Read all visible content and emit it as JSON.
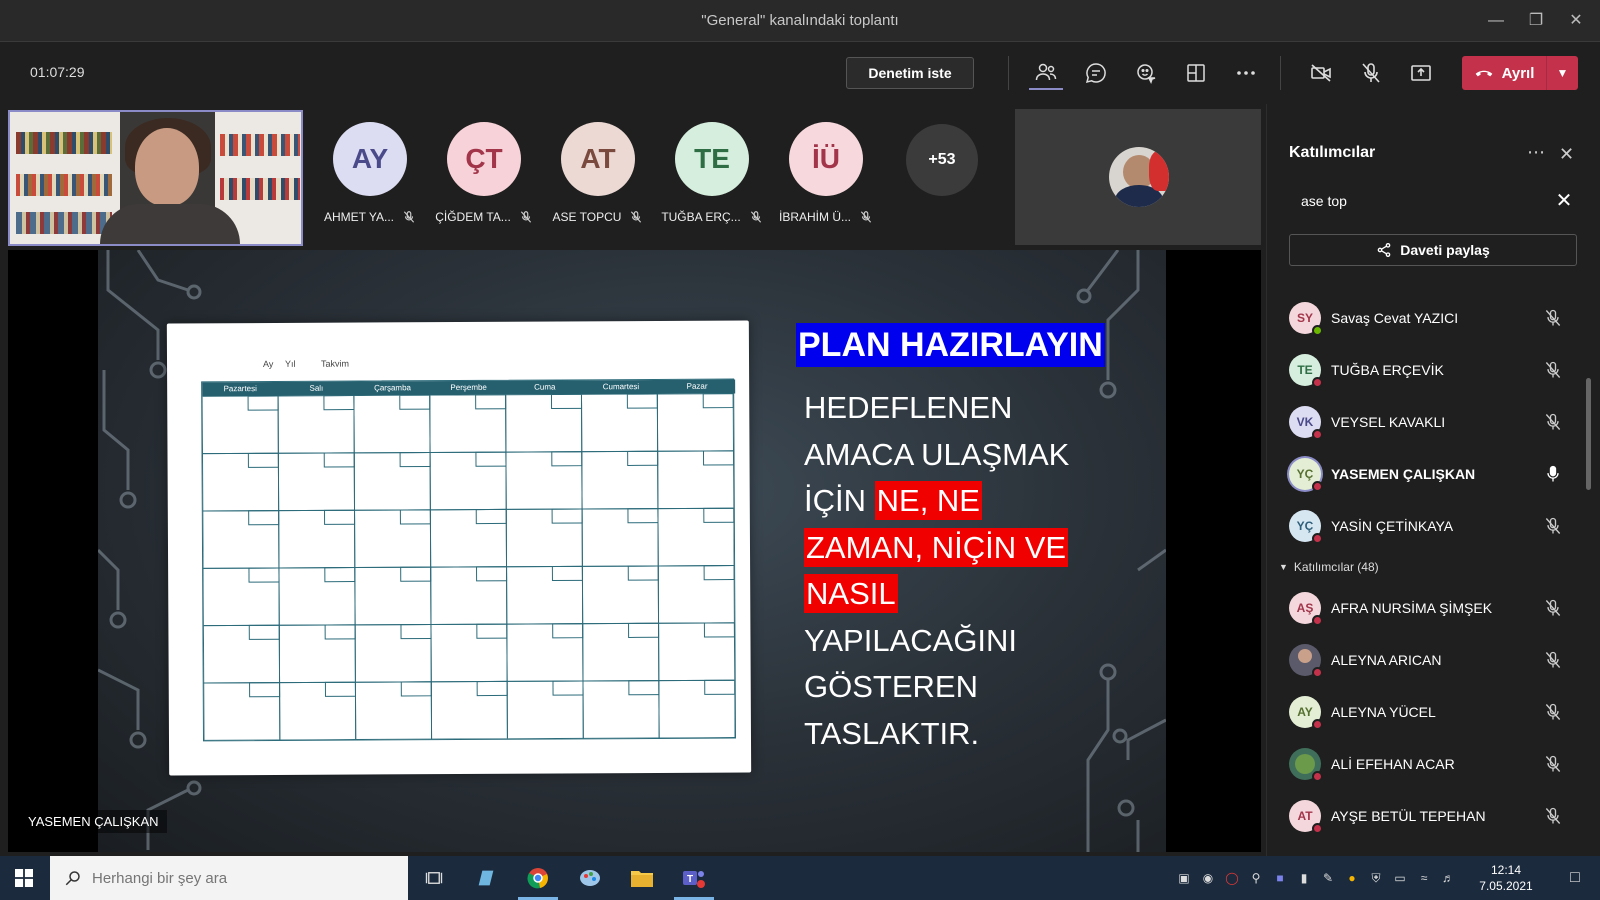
{
  "window": {
    "title": "\"General\" kanalındaki toplantı"
  },
  "toolbar": {
    "timer": "01:07:29",
    "request_control_label": "Denetim iste",
    "leave_label": "Ayrıl",
    "icons": [
      "people-icon",
      "chat-icon",
      "reactions-icon",
      "view-icon",
      "more-icon",
      "camera-off-icon",
      "mic-off-icon",
      "share-icon"
    ]
  },
  "gallery": {
    "avatars": [
      {
        "initials": "AY",
        "name": "AHMET YA...",
        "bg": "#dcdcf2",
        "fg": "#4a4a8a"
      },
      {
        "initials": "ÇT",
        "name": "ÇİĞDEM TA...",
        "bg": "#f7d2d8",
        "fg": "#a2354a"
      },
      {
        "initials": "AT",
        "name": "ASE TOPCU",
        "bg": "#ecd9d4",
        "fg": "#7a4a3e"
      },
      {
        "initials": "TE",
        "name": "TUĞBA ERÇ...",
        "bg": "#d5eedd",
        "fg": "#2f6e45"
      },
      {
        "initials": "İÜ",
        "name": "İBRAHİM Ü...",
        "bg": "#f7d9dd",
        "fg": "#a2354a"
      }
    ],
    "overflow_count": "+53"
  },
  "slide": {
    "calendar": {
      "header": {
        "month": "Ay",
        "year": "Yıl",
        "label": "Takvim"
      },
      "days": [
        "Pazartesi",
        "Salı",
        "Çarşamba",
        "Perşembe",
        "Cuma",
        "Cumartesi",
        "Pazar"
      ]
    },
    "title": "PLAN HAZIRLAYIN",
    "lines": {
      "l1": "HEDEFLENEN",
      "l2": "AMACA ULAŞMAK",
      "l3a": "İÇİN ",
      "l3b": "NE, NE",
      "l4": "ZAMAN, NİÇİN VE",
      "l5": "NASIL",
      "l6": "YAPILACAĞINI",
      "l7": "GÖSTEREN",
      "l8": "TASLAKTIR."
    },
    "presenter": "YASEMEN ÇALIŞKAN"
  },
  "panel": {
    "title": "Katılımcılar",
    "search_value": "ase top",
    "share_invite_label": "Daveti paylaş",
    "section_label": "Katılımcılar (48)",
    "presenters": [
      {
        "initials": "SY",
        "name": "Savaş Cevat YAZICI",
        "bg": "#f3d7dc",
        "fg": "#a2354a",
        "status": "#6bb700",
        "muted": true
      },
      {
        "initials": "TE",
        "name": "TUĞBA ERÇEVİK",
        "bg": "#d5eedd",
        "fg": "#2f6e45",
        "status": "#c4314b",
        "muted": true
      },
      {
        "initials": "VK",
        "name": "VEYSEL KAVAKLI",
        "bg": "#dcdcf2",
        "fg": "#4a4a8a",
        "status": "#c4314b",
        "muted": true
      },
      {
        "initials": "YÇ",
        "name": "YASEMEN ÇALIŞKAN",
        "bg": "#e3eed5",
        "fg": "#55702f",
        "status": "#c4314b",
        "muted": false
      },
      {
        "initials": "YÇ",
        "name": "YASİN ÇETİNKAYA",
        "bg": "#d6e7f2",
        "fg": "#2f5f7a",
        "status": "#c4314b",
        "muted": true
      }
    ],
    "attendees": [
      {
        "initials": "AŞ",
        "name": "AFRA NURSİMA ŞİMŞEK",
        "bg": "#f3d7dc",
        "fg": "#a2354a",
        "status": "#c4314b"
      },
      {
        "initials": "",
        "name": "ALEYNA ARICAN",
        "bg": "#5a5a6a",
        "fg": "#fff",
        "status": "#c4314b"
      },
      {
        "initials": "AY",
        "name": "ALEYNA YÜCEL",
        "bg": "#e3eed5",
        "fg": "#55702f",
        "status": "#c4314b"
      },
      {
        "initials": "",
        "name": "ALİ EFEHAN ACAR",
        "bg": "#3f6e5a",
        "fg": "#fff",
        "status": "#c4314b"
      },
      {
        "initials": "AT",
        "name": "AYŞE BETÜL TEPEHAN",
        "bg": "#f3d7dc",
        "fg": "#a2354a",
        "status": "#c4314b"
      }
    ]
  },
  "taskbar": {
    "search_placeholder": "Herhangi bir şey ara",
    "time": "12:14",
    "date": "7.05.2021"
  }
}
